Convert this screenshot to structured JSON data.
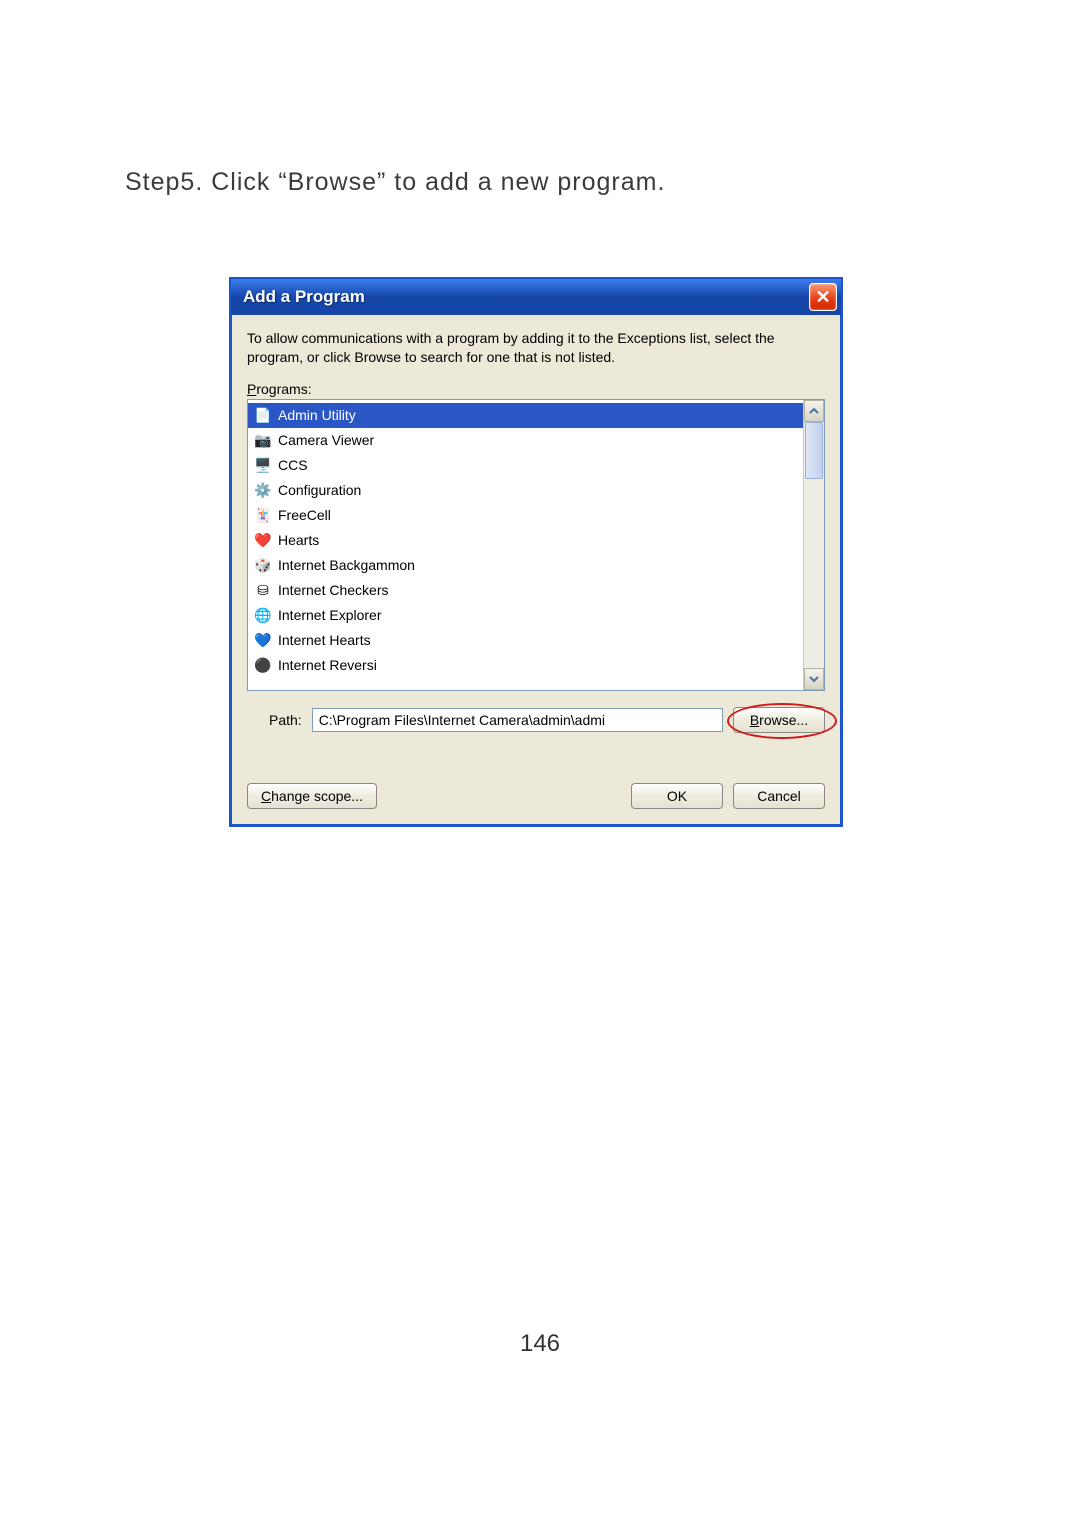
{
  "step_text": "Step5. Click “Browse” to add a new program.",
  "page_number": "146",
  "dialog": {
    "title": "Add a Program",
    "description": "To allow communications with a program by adding it to the Exceptions list, select the program, or click Browse to search for one that is not listed.",
    "programs_label_prefix": "P",
    "programs_label_rest": "rograms:",
    "items": [
      {
        "label": "Admin Utility",
        "icon": "📄",
        "selected": true
      },
      {
        "label": "Camera Viewer",
        "icon": "📷",
        "selected": false
      },
      {
        "label": "CCS",
        "icon": "🖥️",
        "selected": false
      },
      {
        "label": "Configuration",
        "icon": "⚙️",
        "selected": false
      },
      {
        "label": "FreeCell",
        "icon": "🃏",
        "selected": false
      },
      {
        "label": "Hearts",
        "icon": "❤️",
        "selected": false
      },
      {
        "label": "Internet Backgammon",
        "icon": "🎲",
        "selected": false
      },
      {
        "label": "Internet Checkers",
        "icon": "⛁",
        "selected": false
      },
      {
        "label": "Internet Explorer",
        "icon": "🌐",
        "selected": false
      },
      {
        "label": "Internet Hearts",
        "icon": "💙",
        "selected": false
      },
      {
        "label": "Internet Reversi",
        "icon": "⚫",
        "selected": false
      }
    ],
    "path_label": "Path:",
    "path_value": "C:\\Program Files\\Internet Camera\\admin\\admi",
    "browse_prefix": "B",
    "browse_rest": "rowse...",
    "change_scope_prefix": "C",
    "change_scope_rest": "hange scope...",
    "ok_label": "OK",
    "cancel_label": "Cancel"
  }
}
